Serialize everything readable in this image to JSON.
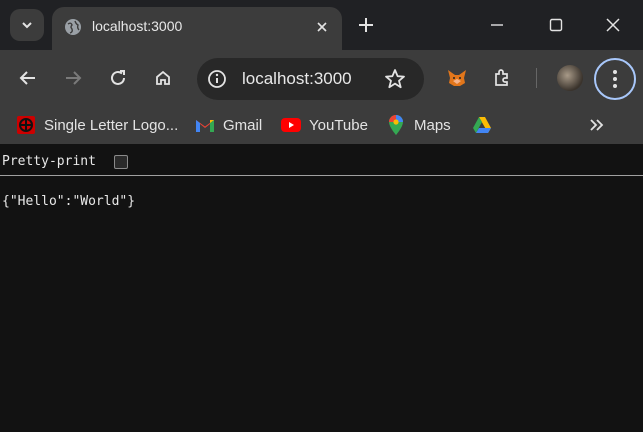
{
  "tab": {
    "title": "localhost:3000"
  },
  "omnibox": {
    "url": "localhost:3000"
  },
  "bookmarks": [
    {
      "label": "Single Letter Logo...",
      "icon": "red-logo-icon"
    },
    {
      "label": "Gmail",
      "icon": "gmail-icon"
    },
    {
      "label": "YouTube",
      "icon": "youtube-icon"
    },
    {
      "label": "Maps",
      "icon": "maps-icon"
    },
    {
      "label": "",
      "icon": "drive-icon"
    }
  ],
  "viewer": {
    "pretty_print_label": "Pretty-print",
    "pretty_print_checked": false,
    "json_text": "{\"Hello\":\"World\"}"
  },
  "colors": {
    "page_bg": "#121212",
    "toolbar_bg": "#3c3c3c",
    "tabstrip_bg": "#202124",
    "focus_ring": "#a8c7fa"
  }
}
